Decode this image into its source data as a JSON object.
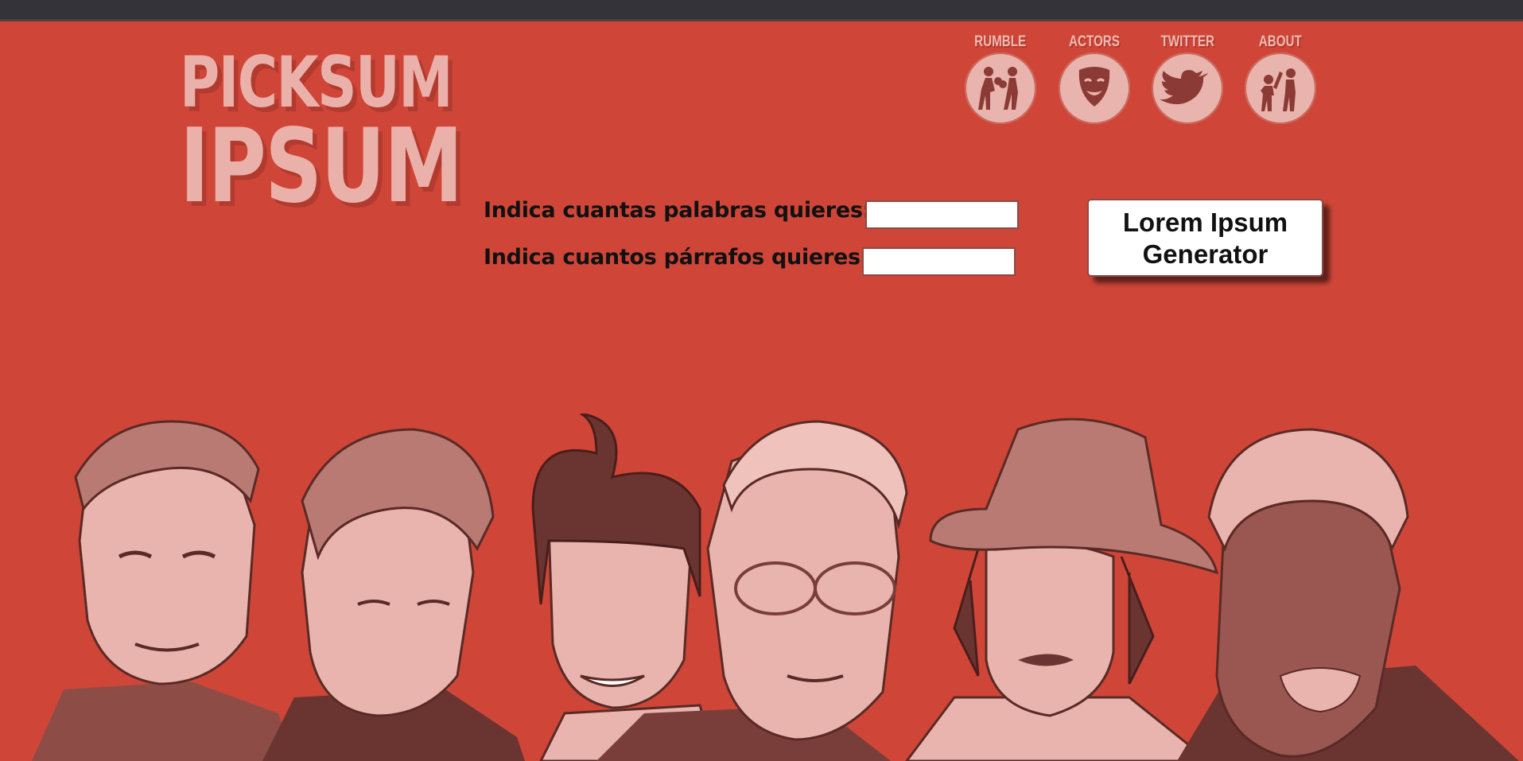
{
  "logo": {
    "line1": "PICKSUM",
    "line2": "IPSUM"
  },
  "nav": [
    {
      "label": "RUMBLE",
      "icon": "boxers-icon"
    },
    {
      "label": "ACTORS",
      "icon": "theatre-mask-icon"
    },
    {
      "label": "TWITTER",
      "icon": "twitter-bird-icon"
    },
    {
      "label": "ABOUT",
      "icon": "high-five-icon"
    }
  ],
  "form": {
    "words_label": "Indica cuantas palabras quieres:",
    "words_value": "",
    "paragraphs_label": "Indica cuantos párrafos quieres:",
    "paragraphs_value": ""
  },
  "generate_button": "Lorem Ipsum\nGenerator",
  "colors": {
    "background": "#cf4638",
    "accent_light": "#e9b4ad",
    "topbar": "#34333a"
  }
}
